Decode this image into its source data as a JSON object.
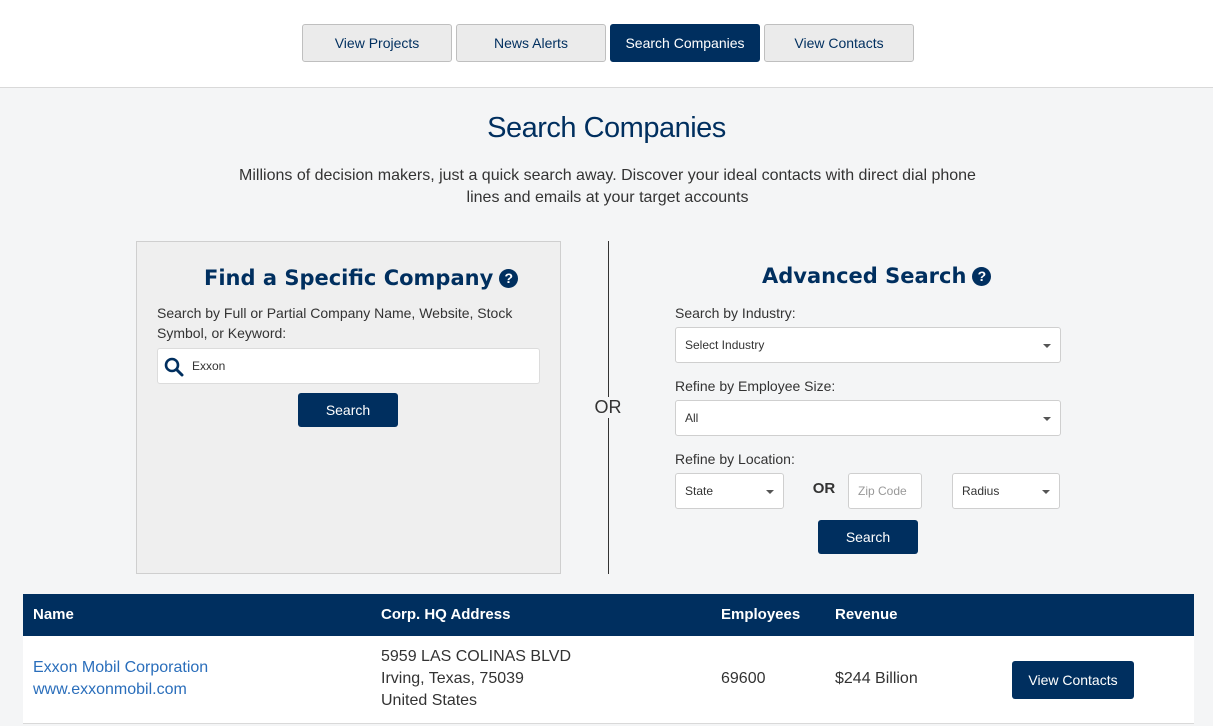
{
  "nav": {
    "items": [
      {
        "label": "View Projects"
      },
      {
        "label": "News Alerts"
      },
      {
        "label": "Search Companies",
        "active": true
      },
      {
        "label": "View Contacts"
      }
    ]
  },
  "page": {
    "title": "Search Companies",
    "intro_line1": "Millions of decision makers, just a quick search away. Discover your ideal contacts with direct dial phone",
    "intro_line2": "lines and emails at your target accounts"
  },
  "find_company": {
    "heading": "Find a Specific Company",
    "help_icon": "question-circle-icon",
    "label_line1": "Search by Full or Partial Company Name, Website, Stock",
    "label_line2": "Symbol, or Keyword:",
    "search_value": "Exxon",
    "search_icon": "search-icon",
    "search_button": "Search"
  },
  "divider_or": "OR",
  "advanced": {
    "heading": "Advanced Search",
    "help_icon": "question-circle-icon",
    "industry_label": "Search by Industry:",
    "industry_selected": "Select Industry",
    "employee_label": "Refine by Employee Size:",
    "employee_selected": "All",
    "location_label": "Refine by Location:",
    "state_selected": "State",
    "or_label": "OR",
    "zip_placeholder": "Zip Code",
    "radius_selected": "Radius",
    "search_button": "Search"
  },
  "results": {
    "columns": [
      "Name",
      "Corp. HQ Address",
      "Employees",
      "Revenue"
    ],
    "rows": [
      {
        "name": "Exxon Mobil Corporation",
        "website": "www.exxonmobil.com",
        "address_line1": "5959 LAS COLINAS BLVD",
        "address_line2": "Irving, Texas, 75039",
        "address_line3": "United States",
        "employees": "69600",
        "revenue": "$244 Billion",
        "action_label": "View Contacts"
      }
    ]
  },
  "colors": {
    "primary": "#002f5f",
    "link": "#2a6ebb",
    "background": "#f4f5f6"
  }
}
